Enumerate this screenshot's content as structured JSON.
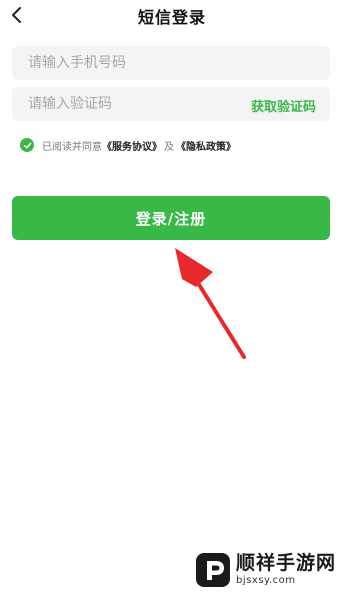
{
  "header": {
    "title": "短信登录",
    "back_icon": "chevron-left-icon"
  },
  "form": {
    "phone_placeholder": "请输入手机号码",
    "code_placeholder": "请输入验证码",
    "get_code_label": "获取验证码"
  },
  "agreement": {
    "checked": true,
    "prefix": "已阅读并同意",
    "service_link": "《服务协议》",
    "conjunction": "及",
    "privacy_link": "《隐私政策》"
  },
  "login_button_label": "登录/注册",
  "watermark": {
    "title": "顺祥手游网",
    "url": "bjsxsy.com"
  },
  "colors": {
    "accent": "#37b847",
    "arrow": "#e8282b",
    "input_bg": "#f4f4f4"
  }
}
